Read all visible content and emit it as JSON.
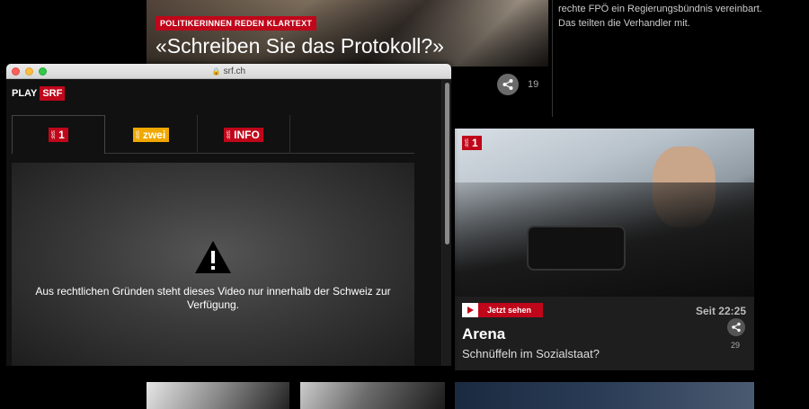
{
  "hero": {
    "badge": "POLITIKERINNEN REDEN KLARTEXT",
    "title": "«Schreiben Sie das Protokoll?»",
    "share_count": "19"
  },
  "side_text": {
    "line1": "rechte FPÖ ein Regierungsbündnis vereinbart.",
    "line2": "Das teilten die Verhandler mit."
  },
  "arena": {
    "live_label": "Jetzt sehen",
    "time": "Seit 22:25",
    "title": "Arena",
    "subtitle": "Schnüffeln im Sozialstaat?",
    "share_count": "29"
  },
  "browser": {
    "url": "srf.ch",
    "brand_play": "PLAY",
    "brand_srf": "SRF",
    "tabs": [
      {
        "label": "1",
        "color": "#c0061a"
      },
      {
        "label": "zwei",
        "color": "#f0a800"
      },
      {
        "label": "info",
        "color": "#c0061a"
      }
    ],
    "message": "Aus rechtlichen Gründen steht dieses Video nur innerhalb der Schweiz zur Verfügung."
  },
  "colors": {
    "accent": "#c0061a",
    "zwei": "#f0a800"
  }
}
